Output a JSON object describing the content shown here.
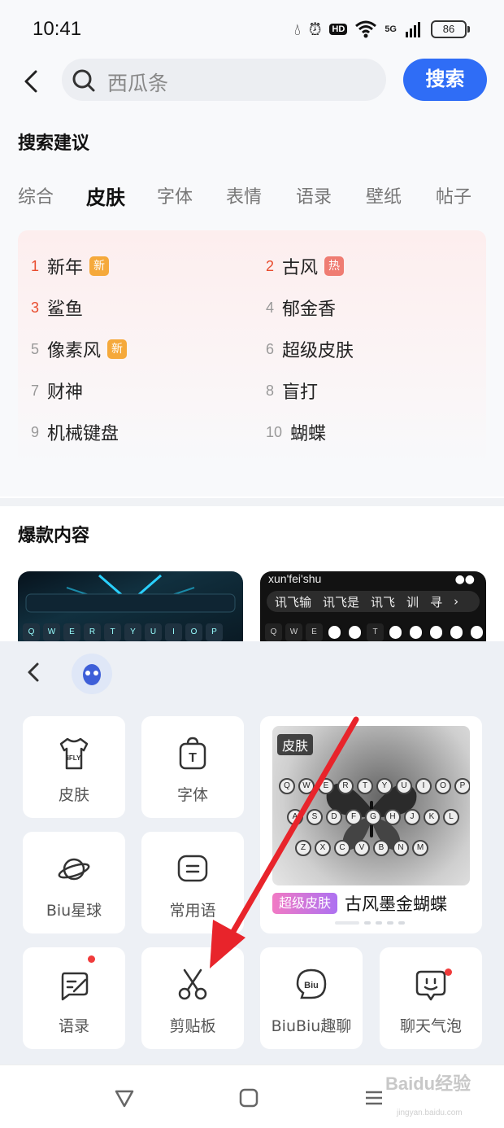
{
  "status": {
    "time": "10:41",
    "hd": "HD",
    "net": "5G",
    "battery": "86"
  },
  "search": {
    "placeholder": "西瓜条",
    "button": "搜索"
  },
  "suggestions": {
    "title": "搜索建议",
    "tabs": [
      "综合",
      "皮肤",
      "字体",
      "表情",
      "语录",
      "壁纸",
      "帖子"
    ],
    "active_tab": "皮肤",
    "ranks": [
      {
        "num": "1",
        "text": "新年",
        "badge": "新"
      },
      {
        "num": "2",
        "text": "古风",
        "badge": "热"
      },
      {
        "num": "3",
        "text": "鲨鱼",
        "badge": ""
      },
      {
        "num": "4",
        "text": "郁金香",
        "badge": ""
      },
      {
        "num": "5",
        "text": "像素风",
        "badge": "新"
      },
      {
        "num": "6",
        "text": "超级皮肤",
        "badge": ""
      },
      {
        "num": "7",
        "text": "财神",
        "badge": ""
      },
      {
        "num": "8",
        "text": "盲打",
        "badge": ""
      },
      {
        "num": "9",
        "text": "机械键盘",
        "badge": ""
      },
      {
        "num": "10",
        "text": "蝴蝶",
        "badge": ""
      }
    ]
  },
  "hot": {
    "title": "爆款内容",
    "thumb2_caption": "xun'fei'shu",
    "thumb2_candidates": [
      "讯飞输",
      "讯飞是",
      "讯飞",
      "训",
      "寻"
    ],
    "thumb1_keys": [
      "Q",
      "W",
      "E",
      "R",
      "T",
      "Y",
      "U",
      "I",
      "O",
      "P"
    ],
    "thumb2_keys": [
      "Q",
      "W",
      "E",
      "",
      "",
      "T",
      "",
      "",
      "",
      "",
      "",
      "P"
    ]
  },
  "panel": {
    "tiles": {
      "skin": "皮肤",
      "font": "字体",
      "planet": "Biu星球",
      "phrases": "常用语",
      "quotes": "语录",
      "clipboard": "剪贴板",
      "biubiu": "BiuBiu趣聊",
      "bubble": "聊天气泡"
    },
    "tile_icon_text": {
      "skin_logo": "iFLY",
      "font_logo": "T",
      "biu_logo": "Biu"
    },
    "feature_card": {
      "preview_tag": "皮肤",
      "tag": "超级皮肤",
      "title": "古风墨金蝴蝶",
      "keys": [
        "Q",
        "W",
        "E",
        "R",
        "T",
        "Y",
        "U",
        "I",
        "O",
        "P",
        "A",
        "S",
        "D",
        "F",
        "G",
        "H",
        "J",
        "K",
        "L",
        "Z",
        "X",
        "C",
        "V",
        "B",
        "N",
        "M"
      ]
    }
  },
  "watermark": {
    "main": "Baidu经验",
    "sub": "jingyan.baidu.com"
  },
  "colors": {
    "accent": "#2f6df6",
    "hot": "#e84c2e",
    "new_badge": "#f5a93b",
    "hot_badge": "#ef7c72",
    "annotation_arrow": "#e8242b"
  }
}
